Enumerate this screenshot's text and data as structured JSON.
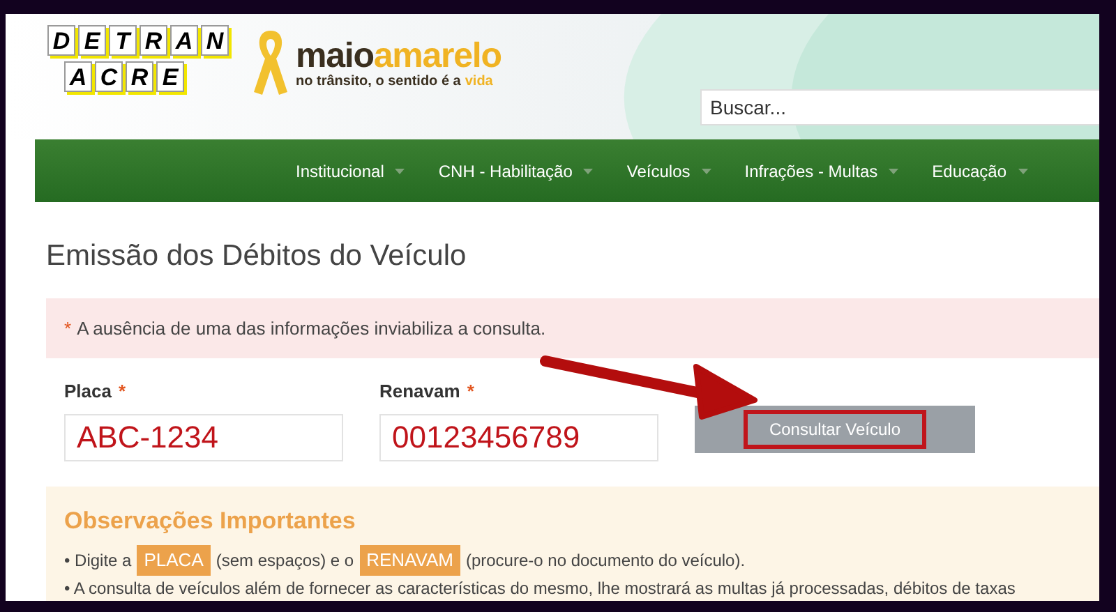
{
  "logo": {
    "top_letters": [
      "D",
      "E",
      "T",
      "R",
      "A",
      "N"
    ],
    "bottom_letters": [
      "A",
      "C",
      "R",
      "E"
    ]
  },
  "campaign": {
    "word_first": "maio",
    "word_second": "amarelo",
    "tagline": "no trânsito, o sentido é a",
    "tagline_highlight": "vida"
  },
  "search": {
    "placeholder": "Buscar..."
  },
  "nav": [
    {
      "label": "Institucional"
    },
    {
      "label": "CNH - Habilitação"
    },
    {
      "label": "Veículos"
    },
    {
      "label": "Infrações - Multas"
    },
    {
      "label": "Educação"
    }
  ],
  "page_title": "Emissão dos Débitos do Veículo",
  "alert": {
    "mark": "*",
    "text": "A ausência de uma das informações inviabiliza a consulta."
  },
  "form": {
    "fields": [
      {
        "label": "Placa",
        "required_mark": "*",
        "value": "ABC-1234"
      },
      {
        "label": "Renavam",
        "required_mark": "*",
        "value": "00123456789"
      }
    ],
    "button": "Consultar Veículo"
  },
  "notes": {
    "title": "Observações Importantes",
    "lines": [
      [
        {
          "kind": "text",
          "text": "• Digite a"
        },
        {
          "kind": "badge",
          "text": "PLACA"
        },
        {
          "kind": "text",
          "text": "(sem espaços) e o"
        },
        {
          "kind": "badge",
          "text": "RENAVAM"
        },
        {
          "kind": "text",
          "text": "(procure-o no documento do veículo)."
        }
      ],
      [
        {
          "kind": "text",
          "text": "• A consulta de veículos além de fornecer as características do mesmo, lhe mostrará as multas já processadas, débitos de taxas"
        }
      ]
    ]
  }
}
